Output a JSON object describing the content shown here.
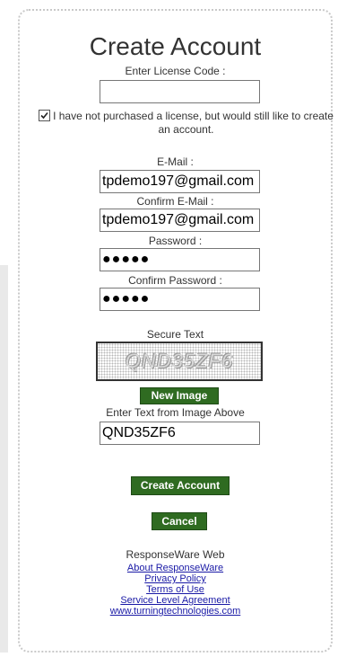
{
  "form": {
    "title": "Create Account",
    "license_label": "Enter License Code :",
    "license_value": "",
    "no_license_text": "I have not purchased a license, but would still like to create an account.",
    "no_license_checked": true,
    "email_label": "E-Mail :",
    "email_value": "tpdemo197@gmail.com",
    "confirm_email_label": "Confirm E-Mail :",
    "confirm_email_value": "tpdemo197@gmail.com",
    "password_label": "Password :",
    "password_mask": "●●●●●",
    "confirm_password_label": "Confirm Password :",
    "confirm_password_mask": "●●●●●",
    "secure_text_label": "Secure Text",
    "captcha_text": "QND35ZF6",
    "new_image_button": "New Image",
    "captcha_input_label": "Enter Text from Image Above",
    "captcha_input_value": "QND35ZF6",
    "create_button": "Create Account",
    "cancel_button": "Cancel"
  },
  "footer": {
    "app_name": "ResponseWare Web",
    "links": [
      "About ResponseWare",
      "Privacy Policy",
      "Terms of Use",
      "Service Level Agreement",
      "www.turningtechnologies.com"
    ]
  },
  "colors": {
    "button_green": "#2f6b21",
    "link_blue": "#1a1aa6"
  }
}
